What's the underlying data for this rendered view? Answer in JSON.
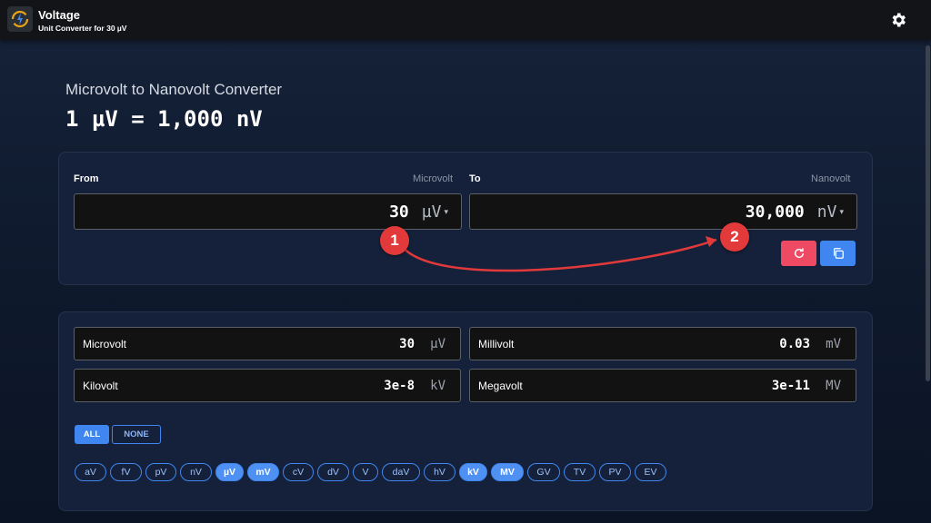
{
  "app": {
    "title": "Voltage",
    "subtitle": "Unit Converter for 30 µV",
    "icons": {
      "logo": "voltage-logo-icon",
      "settings": "gear-icon"
    }
  },
  "heading": {
    "title": "Microvolt to Nanovolt Converter",
    "equation": "1 µV = 1,000 nV"
  },
  "converter": {
    "from": {
      "label": "From",
      "unit_name": "Microvolt",
      "value": "30",
      "unit": "µV",
      "caret": "▾"
    },
    "to": {
      "label": "To",
      "unit_name": "Nanovolt",
      "value": "30,000",
      "unit": "nV",
      "caret": "▾"
    },
    "buttons": {
      "reset_icon": "refresh-icon",
      "copy_icon": "copy-icon",
      "reset_color": "#ef4a63",
      "copy_color": "#3f86f0"
    }
  },
  "results": [
    {
      "name": "Microvolt",
      "value": "30",
      "unit": "µV"
    },
    {
      "name": "Millivolt",
      "value": "0.03",
      "unit": "mV"
    },
    {
      "name": "Kilovolt",
      "value": "3e-8",
      "unit": "kV"
    },
    {
      "name": "Megavolt",
      "value": "3e-11",
      "unit": "MV"
    }
  ],
  "filters": {
    "all_label": "ALL",
    "none_label": "NONE",
    "units": [
      {
        "label": "aV",
        "selected": false
      },
      {
        "label": "fV",
        "selected": false
      },
      {
        "label": "pV",
        "selected": false
      },
      {
        "label": "nV",
        "selected": false
      },
      {
        "label": "µV",
        "selected": true
      },
      {
        "label": "mV",
        "selected": true
      },
      {
        "label": "cV",
        "selected": false
      },
      {
        "label": "dV",
        "selected": false
      },
      {
        "label": "V",
        "selected": false
      },
      {
        "label": "daV",
        "selected": false
      },
      {
        "label": "hV",
        "selected": false
      },
      {
        "label": "kV",
        "selected": true
      },
      {
        "label": "MV",
        "selected": true
      },
      {
        "label": "GV",
        "selected": false
      },
      {
        "label": "TV",
        "selected": false
      },
      {
        "label": "PV",
        "selected": false
      },
      {
        "label": "EV",
        "selected": false
      }
    ]
  },
  "annotations": {
    "marker_1": "1",
    "marker_2": "2",
    "color": "#e23a3a"
  },
  "colors": {
    "accent": "#3f86f0",
    "danger": "#ef4a63",
    "background": "#16233a"
  }
}
